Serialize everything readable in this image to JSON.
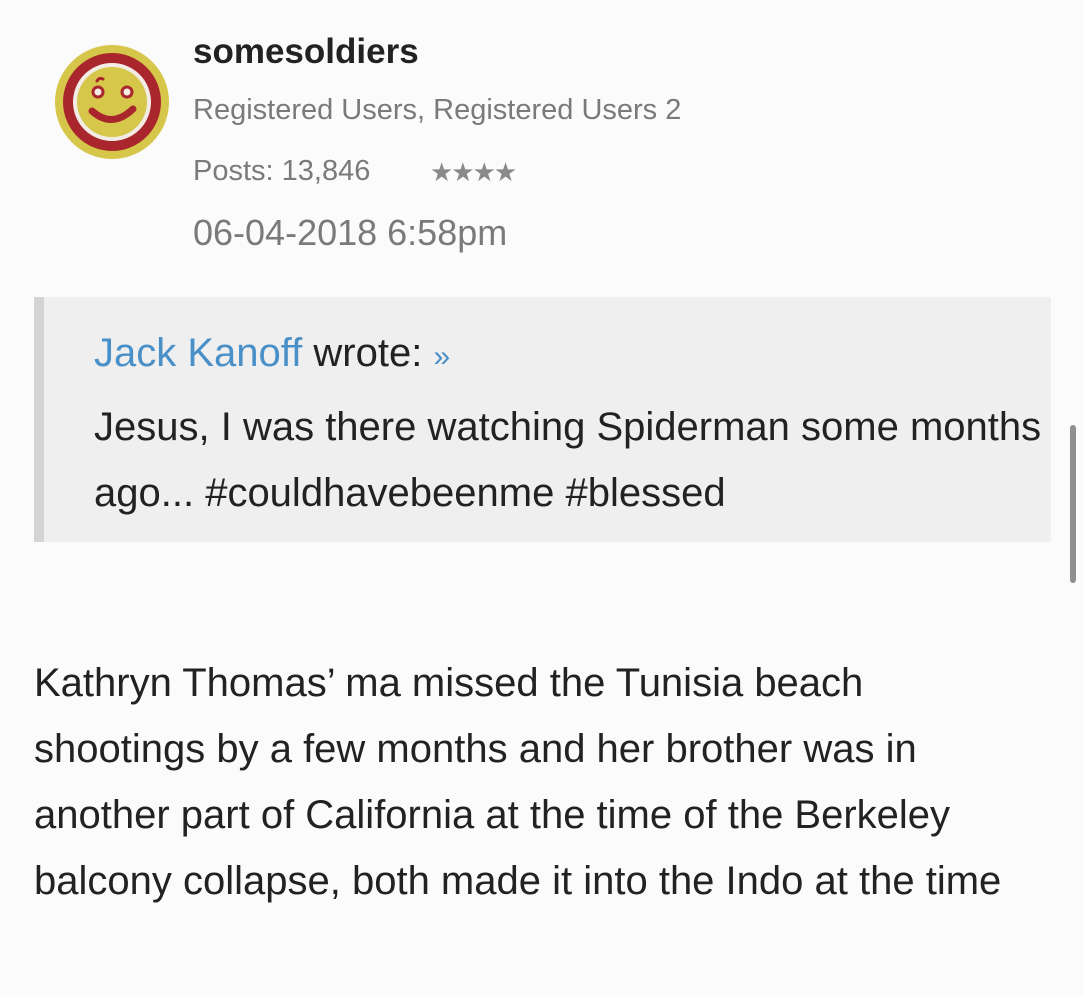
{
  "post": {
    "author": {
      "username": "somesoldiers",
      "roles": "Registered Users, Registered Users 2",
      "posts_label": "Posts: 13,846",
      "rank_stars": "★★★★",
      "avatar_icon": "smiley-wink-icon"
    },
    "timestamp": "06-04-2018 6:58pm",
    "quote": {
      "author": "Jack Kanoff",
      "wrote_label": " wrote: ",
      "link_glyph": "»",
      "text": "Jesus, I was there watching Spiderman some months ago... #couldhavebeenme #blessed"
    },
    "body": "Kathryn Thomas’ ma missed the Tunisia beach shootings by a few months and her brother was in another part of California at the time of the Berkeley balcony collapse, both made it into the Indo at the time"
  },
  "colors": {
    "link": "#4a90c8",
    "avatar_face": "#d6c64a",
    "avatar_ring": "#a8262c"
  }
}
